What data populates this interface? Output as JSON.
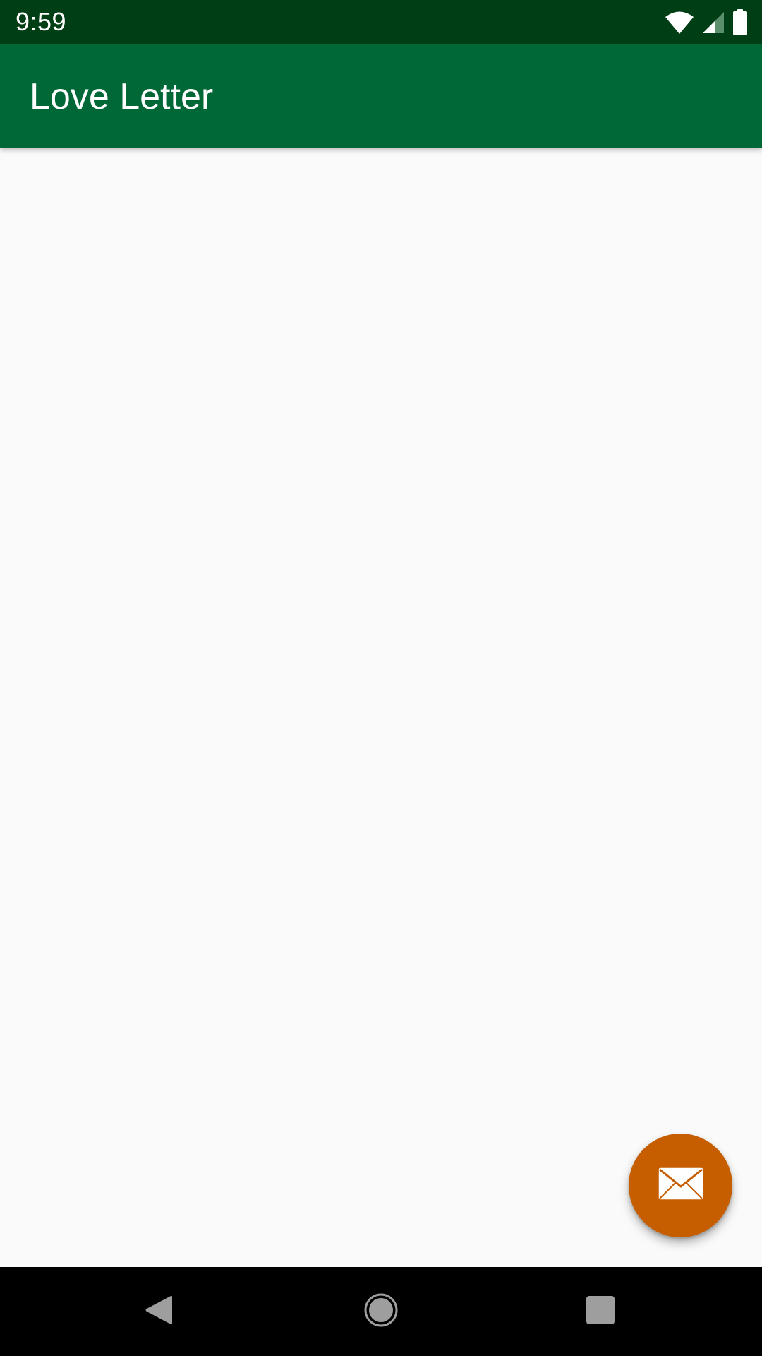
{
  "status_bar": {
    "time": "9:59",
    "background": "#003e15",
    "icons": [
      "wifi-icon",
      "cell-signal-icon",
      "battery-icon"
    ]
  },
  "app_bar": {
    "title": "Love Letter",
    "background": "#006837"
  },
  "fab": {
    "icon": "envelope-icon",
    "color": "#c65e00"
  },
  "nav_bar": {
    "buttons": [
      "back-icon",
      "home-icon",
      "recents-icon"
    ]
  }
}
